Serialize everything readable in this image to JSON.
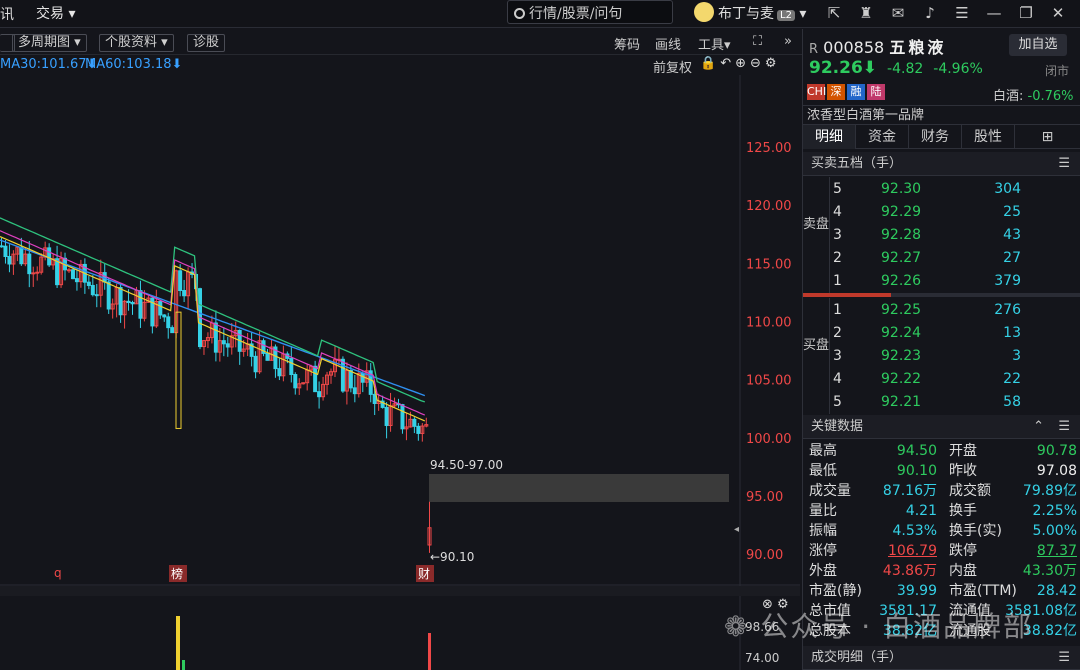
{
  "topbar": {
    "cut_char": "讯",
    "trade": "交易 ▾",
    "search_placeholder": "行情/股票/问句",
    "user": "布丁与麦",
    "badge": "L2"
  },
  "toolbar": {
    "period": "多周期图 ▾",
    "profile": "个股资料 ▾",
    "diag": "诊股",
    "chips": "筹码",
    "draw": "画线",
    "tools": "工具▾",
    "more": "»",
    "adjust": "前复权"
  },
  "legend": {
    "ma30": "MA30:101.67⬇",
    "ma60": "MA60:103.18⬇"
  },
  "chart": {
    "yticks": [
      "125.00",
      "120.00",
      "115.00",
      "110.00",
      "105.00",
      "100.00",
      "95.00",
      "90.00"
    ],
    "gap_label": "94.50-97.00",
    "low_label": "←90.10",
    "markers": [
      "q",
      "榜",
      "财"
    ],
    "vol_ticks": [
      "98.66",
      "74.00"
    ]
  },
  "chart_data": {
    "type": "candlestick",
    "ylim": [
      88,
      130
    ],
    "yticks": [
      125,
      120,
      115,
      110,
      105,
      100,
      95,
      90
    ],
    "last": {
      "open": 90.78,
      "high": 94.5,
      "low": 90.1,
      "close": 92.26,
      "prev_close": 97.08
    },
    "gap": [
      94.5,
      97.0
    ],
    "ma30": 101.67,
    "ma60": 103.18
  },
  "stock": {
    "prefix": "R",
    "code": "000858",
    "name": "五粮液",
    "add": "加自选",
    "price": "92.26",
    "arrow": "⬇",
    "change": "-4.82",
    "pct": "-4.96%",
    "status": "闭市",
    "tags": [
      "CHI",
      "深",
      "融",
      "陆"
    ],
    "sector": "白酒:",
    "sector_pct": "-0.76%",
    "desc": "浓香型白酒第一品牌"
  },
  "tabs": [
    "明细",
    "资金",
    "财务",
    "股性"
  ],
  "book": {
    "title": "买卖五档（手）",
    "sell_label": "卖盘",
    "buy_label": "买盘",
    "sell": [
      {
        "l": "5",
        "p": "92.30",
        "v": "304"
      },
      {
        "l": "4",
        "p": "92.29",
        "v": "25"
      },
      {
        "l": "3",
        "p": "92.28",
        "v": "43"
      },
      {
        "l": "2",
        "p": "92.27",
        "v": "27"
      },
      {
        "l": "1",
        "p": "92.26",
        "v": "379"
      }
    ],
    "buy": [
      {
        "l": "1",
        "p": "92.25",
        "v": "276"
      },
      {
        "l": "2",
        "p": "92.24",
        "v": "13"
      },
      {
        "l": "3",
        "p": "92.23",
        "v": "3"
      },
      {
        "l": "4",
        "p": "92.22",
        "v": "22"
      },
      {
        "l": "5",
        "p": "92.21",
        "v": "58"
      }
    ]
  },
  "key": {
    "title": "关键数据",
    "rows": [
      {
        "a": "最高",
        "av": "94.50",
        "ac": "green",
        "b": "开盘",
        "bv": "90.78",
        "bc": "green"
      },
      {
        "a": "最低",
        "av": "90.10",
        "ac": "green",
        "b": "昨收",
        "bv": "97.08",
        "bc": "white"
      },
      {
        "a": "成交量",
        "av": "87.16万",
        "ac": "cyan",
        "b": "成交额",
        "bv": "79.89亿",
        "bc": "cyan"
      },
      {
        "a": "量比",
        "av": "4.21",
        "ac": "cyan",
        "b": "换手",
        "bv": "2.25%",
        "bc": "cyan"
      },
      {
        "a": "振幅",
        "av": "4.53%",
        "ac": "cyan",
        "b": "换手(实)",
        "bv": "5.00%",
        "bc": "cyan"
      },
      {
        "a": "涨停",
        "av": "106.79",
        "ac": "red ul",
        "b": "跌停",
        "bv": "87.37",
        "bc": "green ul"
      },
      {
        "a": "外盘",
        "av": "43.86万",
        "ac": "red",
        "b": "内盘",
        "bv": "43.30万",
        "bc": "green"
      },
      {
        "a": "市盈(静)",
        "av": "39.99",
        "ac": "cyan",
        "b": "市盈(TTM)",
        "bv": "28.42",
        "bc": "cyan"
      },
      {
        "a": "总市值",
        "av": "3581.17亿",
        "ac": "cyan",
        "b": "流通值",
        "bv": "3581.08亿",
        "bc": "cyan"
      },
      {
        "a": "总股本",
        "av": "38.82亿",
        "ac": "cyan",
        "b": "流通股",
        "bv": "38.82亿",
        "bc": "cyan"
      }
    ]
  },
  "detail_title": "成交明细（手）",
  "watermark": "公众号 · 白酒品牌部"
}
